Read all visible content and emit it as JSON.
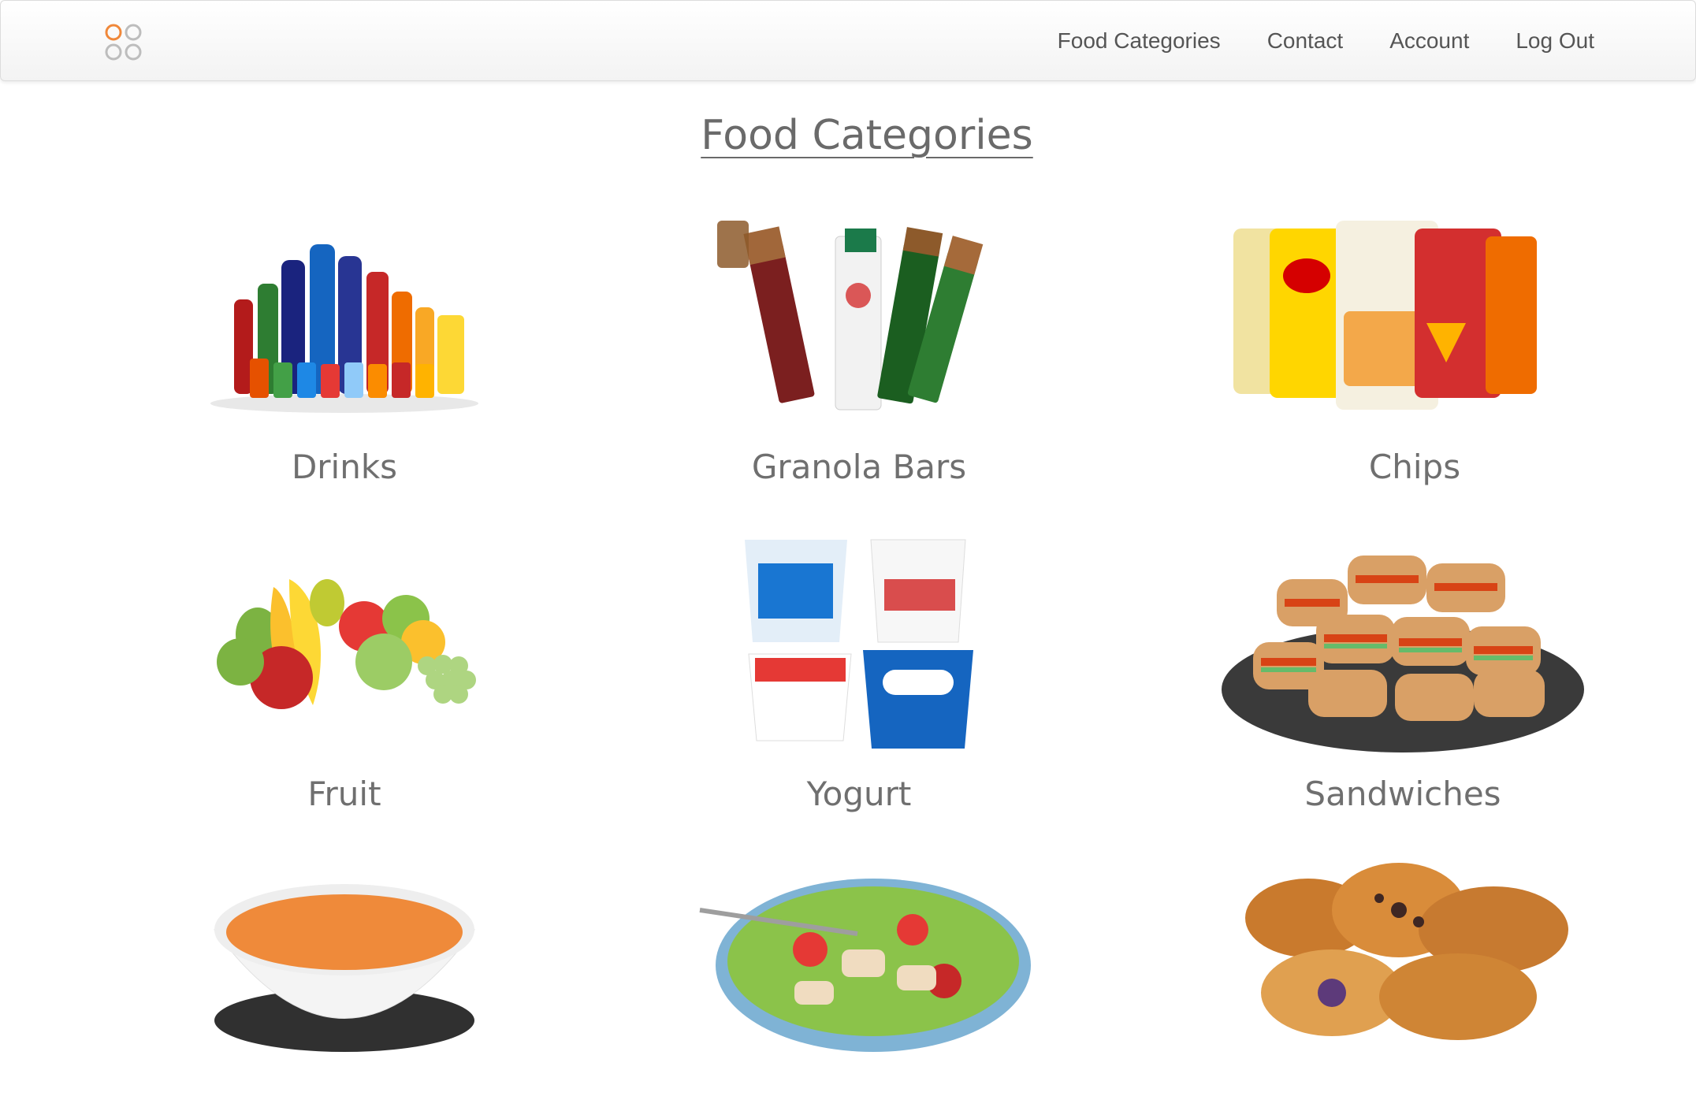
{
  "nav": {
    "logo_icon": "four-circles-logo-icon",
    "links": [
      "Food Categories",
      "Contact",
      "Account",
      "Log Out"
    ]
  },
  "page": {
    "title": "Food Categories"
  },
  "categories": [
    {
      "label": "Drinks",
      "icon": "drinks-bottles-icon"
    },
    {
      "label": "Granola Bars",
      "icon": "granola-bars-icon"
    },
    {
      "label": "Chips",
      "icon": "chip-bags-icon"
    },
    {
      "label": "Fruit",
      "icon": "fruit-pile-icon"
    },
    {
      "label": "Yogurt",
      "icon": "yogurt-cups-icon"
    },
    {
      "label": "Sandwiches",
      "icon": "sandwich-platter-icon"
    },
    {
      "label": "",
      "icon": "soup-bowl-icon"
    },
    {
      "label": "",
      "icon": "salad-plate-icon"
    },
    {
      "label": "",
      "icon": "pastries-icon"
    }
  ],
  "colors": {
    "logo_orange": "#F0883A",
    "logo_gray": "#BDBDBD",
    "text": "#6f6f6f"
  }
}
